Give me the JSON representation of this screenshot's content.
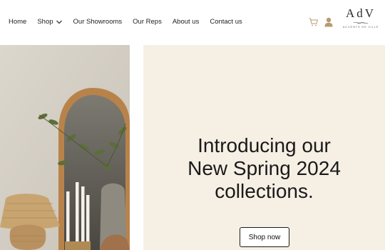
{
  "nav": {
    "items": [
      {
        "label": "Home"
      },
      {
        "label": "Shop",
        "has_dropdown": true
      },
      {
        "label": "Our Showrooms"
      },
      {
        "label": "Our Reps"
      },
      {
        "label": "About us"
      },
      {
        "label": "Contact us"
      }
    ]
  },
  "header_icons": {
    "cart": "cart-icon",
    "account": "user-icon",
    "accent": "#b79a6e"
  },
  "logo": {
    "mark": "AdV",
    "tagline": "ACCENTS DE VILLE"
  },
  "hero": {
    "headline_lines": [
      "Introducing our",
      "New Spring 2024",
      "collections."
    ],
    "cta_label": "Shop now",
    "background": "#f6efe4"
  }
}
